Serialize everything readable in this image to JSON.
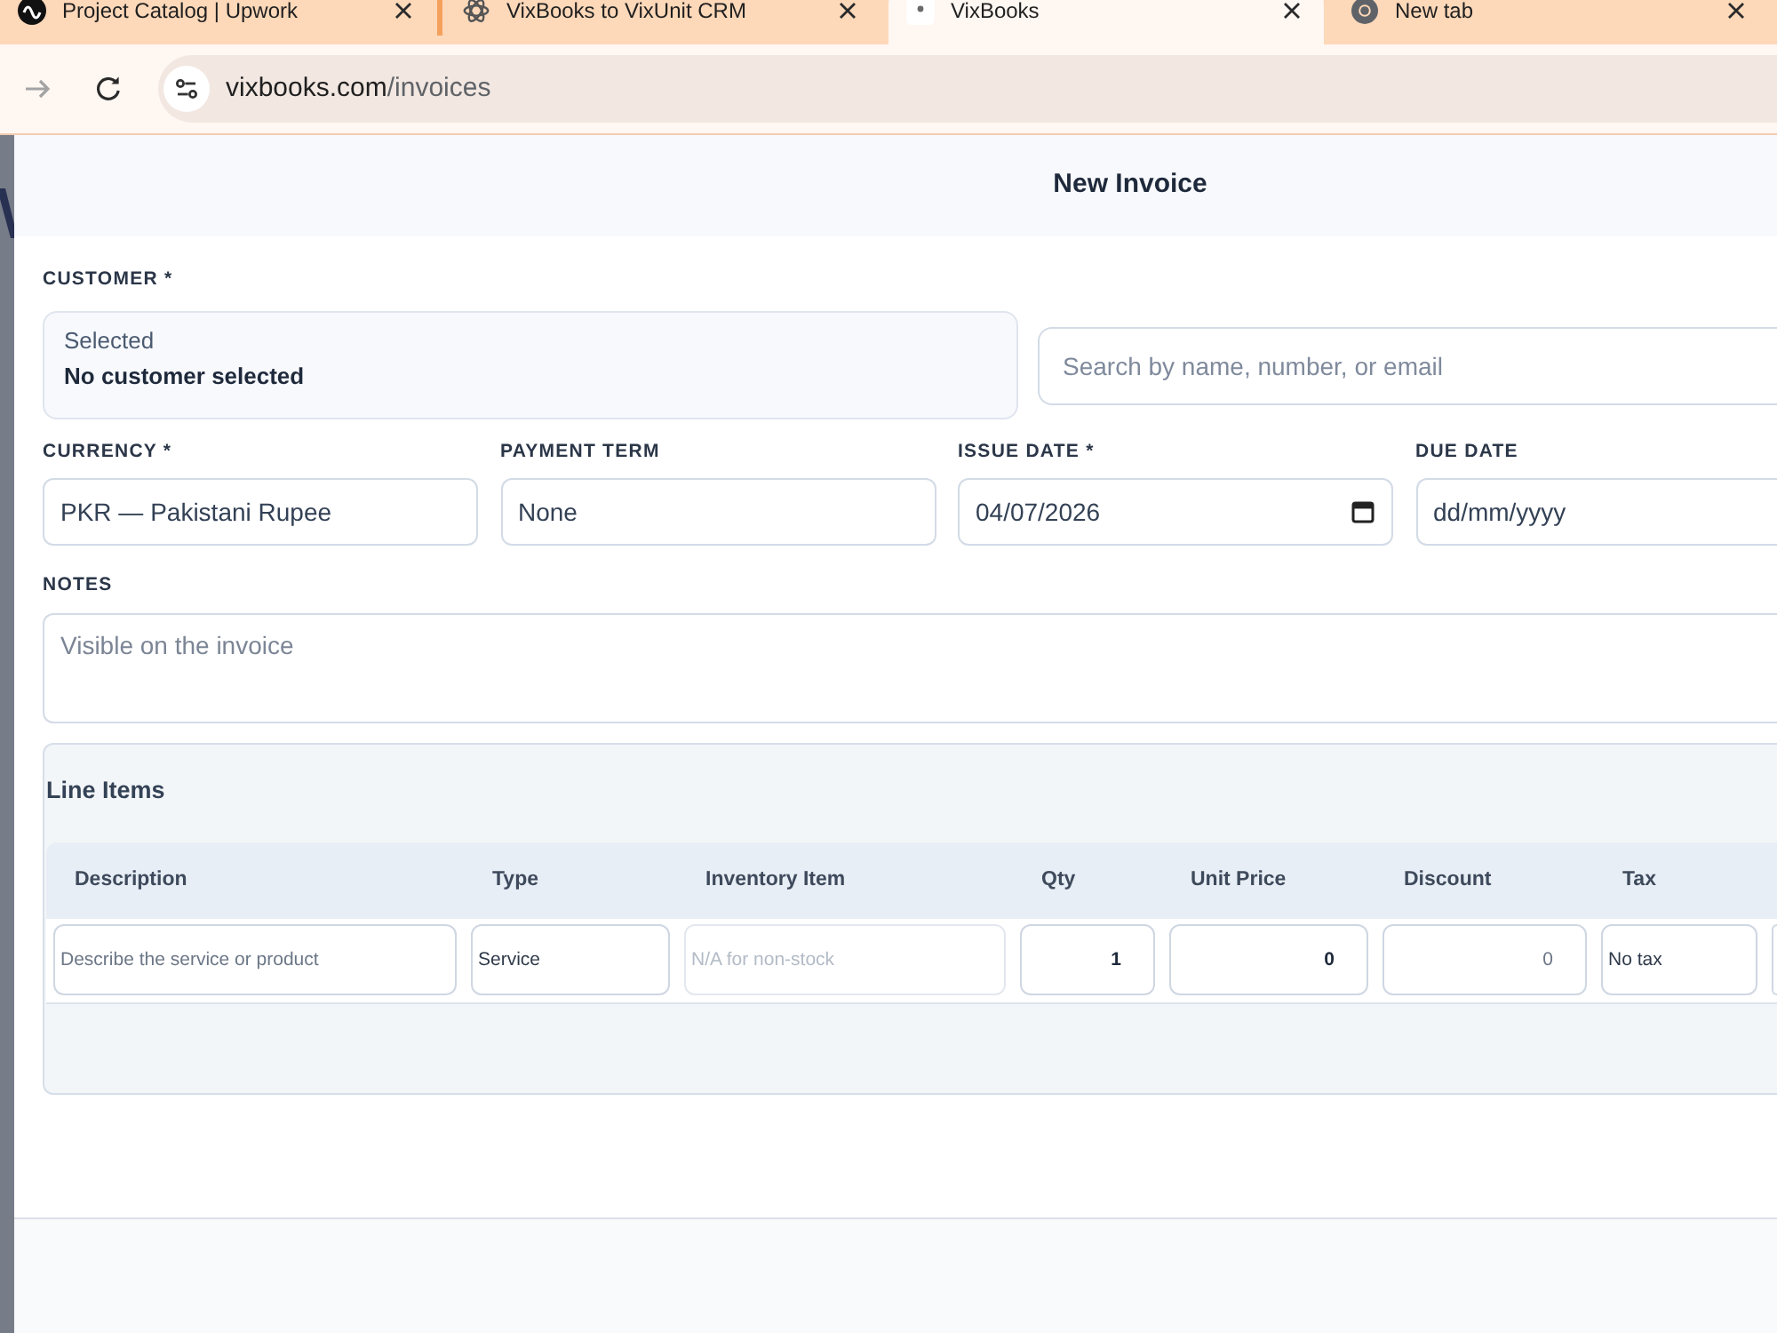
{
  "browser": {
    "tabs": [
      {
        "title": "Project Catalog | Upwork",
        "selected": false
      },
      {
        "title": "VixBooks to VixUnit CRM",
        "selected": false
      },
      {
        "title": "VixBooks",
        "selected": true
      },
      {
        "title": "New tab",
        "selected": false
      }
    ],
    "forward_button": {
      "disabled": true
    },
    "address": {
      "host": "vixbooks.com",
      "path": "/invoices"
    }
  },
  "modal": {
    "title": "New Invoice",
    "customer": {
      "label": "CUSTOMER *",
      "caption": "Selected",
      "selection": "No customer selected",
      "search": {
        "placeholder": "Search by name, number, or email"
      }
    },
    "fields": [
      {
        "label": "CURRENCY *",
        "value": "PKR — Pakistani Rupee"
      },
      {
        "label": "PAYMENT TERM",
        "value": "None"
      },
      {
        "label": "ISSUE DATE *",
        "value": "04/07/2026",
        "picker_button": true
      },
      {
        "label": "DUE DATE",
        "placeholder": "dd/mm/yyyy"
      }
    ],
    "notes": {
      "label": "NOTES",
      "placeholder": "Visible on the invoice"
    },
    "line_items": {
      "title": "Line Items",
      "columns": [
        "Description",
        "Type",
        "Inventory Item",
        "Qty",
        "Unit Price",
        "Discount",
        "Tax"
      ],
      "rows": [
        {
          "cells": [
            {
              "kind": "text",
              "placeholder": "Describe the service or product",
              "disabled": false
            },
            {
              "kind": "text",
              "value": "Service",
              "disabled": false
            },
            {
              "kind": "text",
              "placeholder": "N/A for non-stock",
              "disabled": true
            },
            {
              "kind": "number",
              "value": "1",
              "disabled": false
            },
            {
              "kind": "number",
              "value": "0",
              "disabled": false
            },
            {
              "kind": "number",
              "placeholder": "0",
              "disabled": false
            },
            {
              "kind": "text",
              "value": "No tax",
              "disabled": false
            },
            {
              "kind": "text",
              "disabled": false
            }
          ]
        }
      ]
    }
  }
}
